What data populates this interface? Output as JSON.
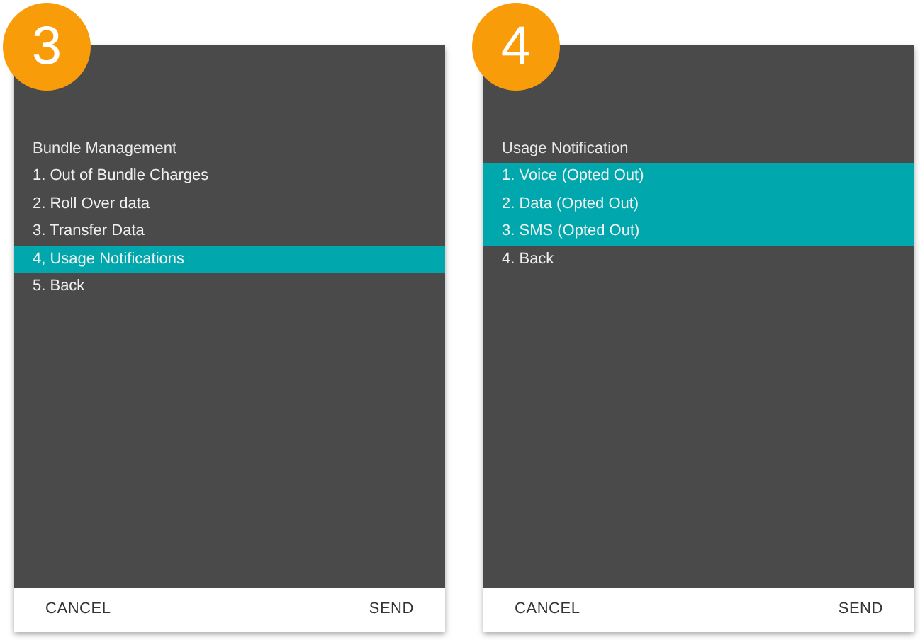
{
  "screens": [
    {
      "step": "3",
      "heading": "Bundle Management",
      "items": [
        {
          "label": "1. Out of Bundle Charges",
          "selected": false
        },
        {
          "label": "2. Roll Over data",
          "selected": false
        },
        {
          "label": "3. Transfer Data",
          "selected": false
        },
        {
          "label": "4, Usage Notifications",
          "selected": true
        },
        {
          "label": "5. Back",
          "selected": false
        }
      ],
      "buttons": [
        "CANCEL",
        "SEND"
      ]
    },
    {
      "step": "4",
      "heading": "Usage Notification",
      "items": [
        {
          "label": "1. Voice (Opted Out)",
          "selected": true
        },
        {
          "label": "2. Data (Opted Out)",
          "selected": true
        },
        {
          "label": "3. SMS (Opted Out)",
          "selected": true
        },
        {
          "label": "4. Back",
          "selected": false
        }
      ],
      "buttons": [
        "CANCEL",
        "SEND"
      ]
    }
  ]
}
